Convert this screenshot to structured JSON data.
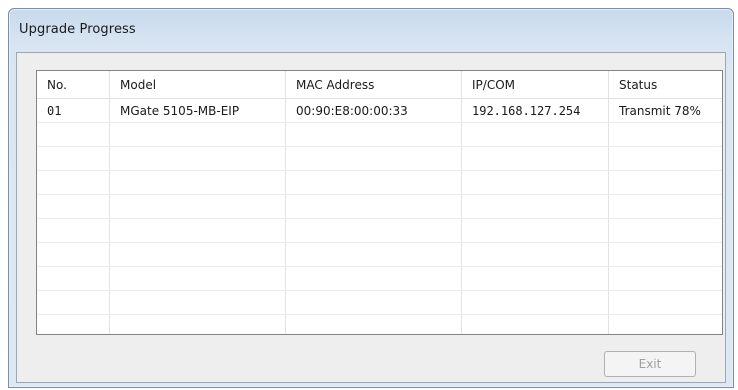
{
  "window": {
    "title": "Upgrade Progress"
  },
  "table": {
    "columns": [
      "No.",
      "Model",
      "MAC Address",
      "IP/COM",
      "Status"
    ],
    "rows": [
      {
        "no": "01",
        "model": "MGate 5105-MB-EIP",
        "mac": "00:90:E8:00:00:33",
        "ip": "192.168.127.254",
        "status": "Transmit 78%"
      }
    ]
  },
  "buttons": {
    "exit_label": "Exit"
  }
}
